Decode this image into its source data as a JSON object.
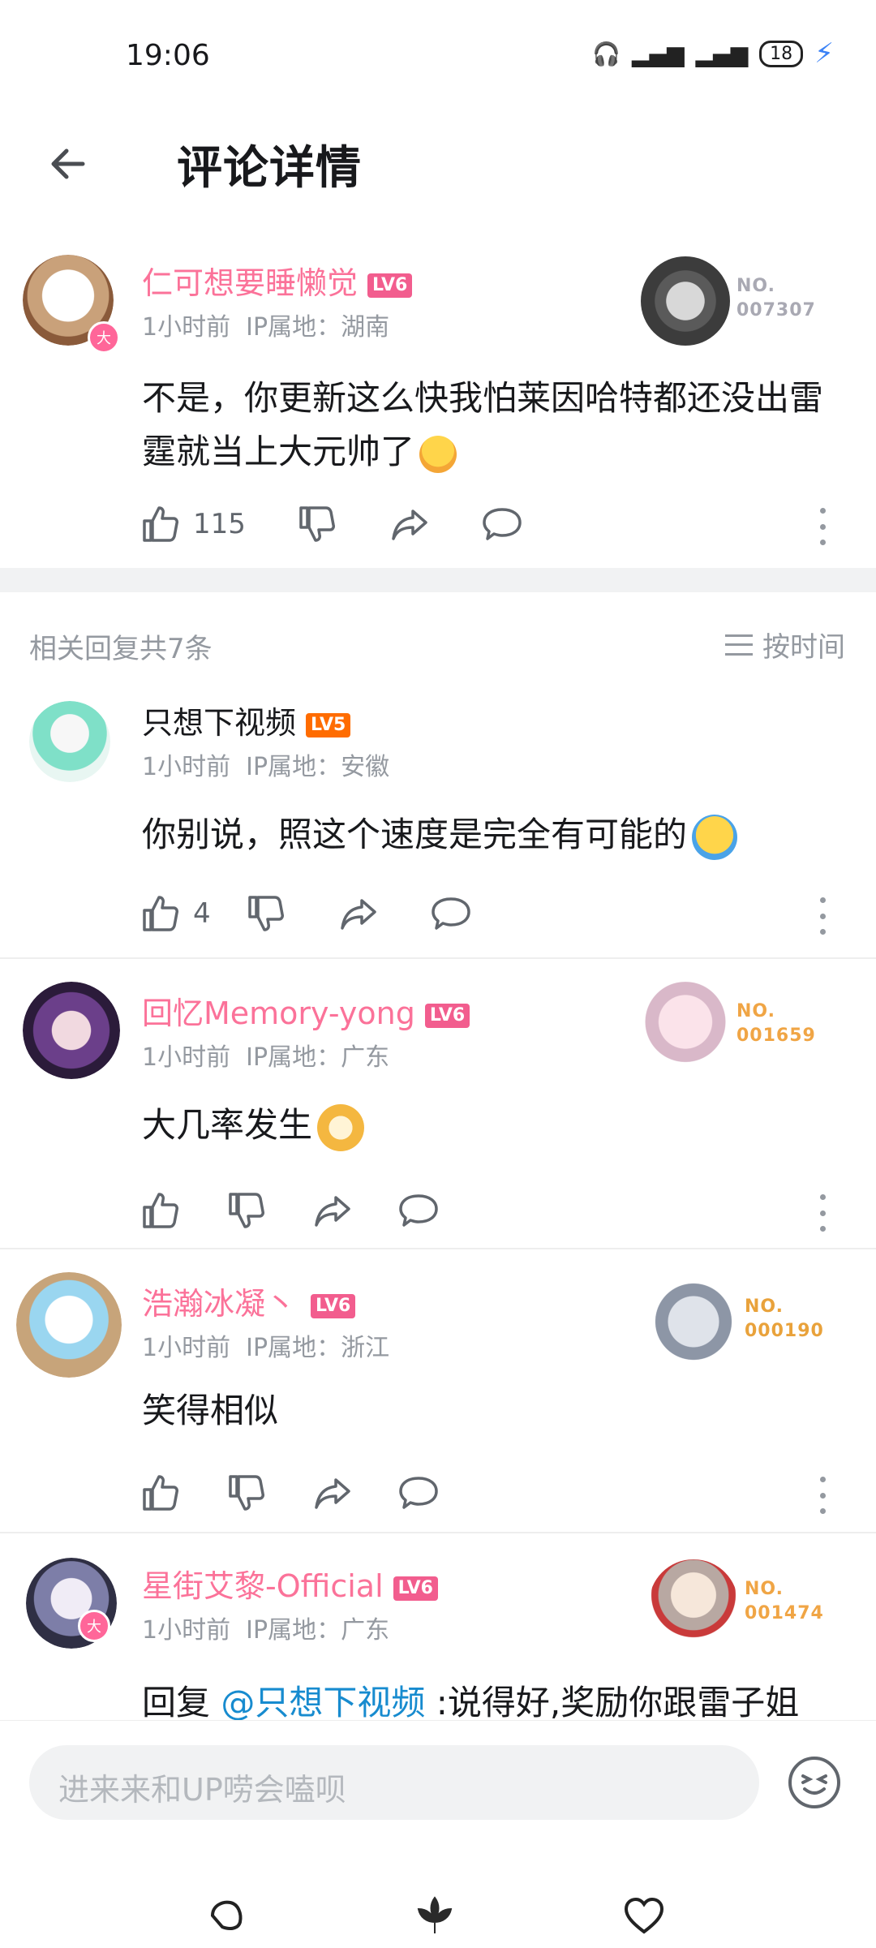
{
  "status": {
    "time": "19:06",
    "battery": "18"
  },
  "header": {
    "title": "评论详情"
  },
  "main_comment": {
    "username": "仁可想要睡懒觉",
    "level": "LV6",
    "time": "1小时前",
    "ip": "IP属地：湖南",
    "text": "不是，你更新这么快我怕莱因哈特都还没出雷霆就当上大元帅了",
    "likes": "115",
    "fan_no_label": "NO.",
    "fan_no": "007307",
    "avatar_badge": "大"
  },
  "replies_header": {
    "count_label": "相关回复共7条",
    "sort_label": "按时间"
  },
  "replies": [
    {
      "username": "只想下视频",
      "level": "LV5",
      "time": "1小时前",
      "ip": "IP属地：安徽",
      "text": "你别说，照这个速度是完全有可能的",
      "likes": "4"
    },
    {
      "username": "回忆Memory-yong",
      "level": "LV6",
      "time": "1小时前",
      "ip": "IP属地：广东",
      "text": "大几率发生",
      "fan_no_label": "NO.",
      "fan_no": "001659"
    },
    {
      "username": "浩瀚冰凝丶",
      "level": "LV6",
      "time": "1小时前",
      "ip": "IP属地：浙江",
      "text": "笑得相似",
      "fan_no_label": "NO.",
      "fan_no": "000190"
    },
    {
      "username": "星街艾黎-Official",
      "level": "LV6",
      "time": "1小时前",
      "ip": "IP属地：广东",
      "reply_prefix": "回复 ",
      "mention": "@只想下视频",
      "text": " :说得好,奖励你跟雷子姐",
      "fan_no_label": "NO.",
      "fan_no": "001474",
      "avatar_badge": "大"
    }
  ],
  "input": {
    "placeholder": "进来来和UP唠会嗑呗"
  },
  "colors": {
    "pink": "#fb7299",
    "fan_gray": "#a9a9b3",
    "fan_gold": "#e9a23b",
    "fan_orange": "#f0a545",
    "mention": "#178bcf"
  }
}
